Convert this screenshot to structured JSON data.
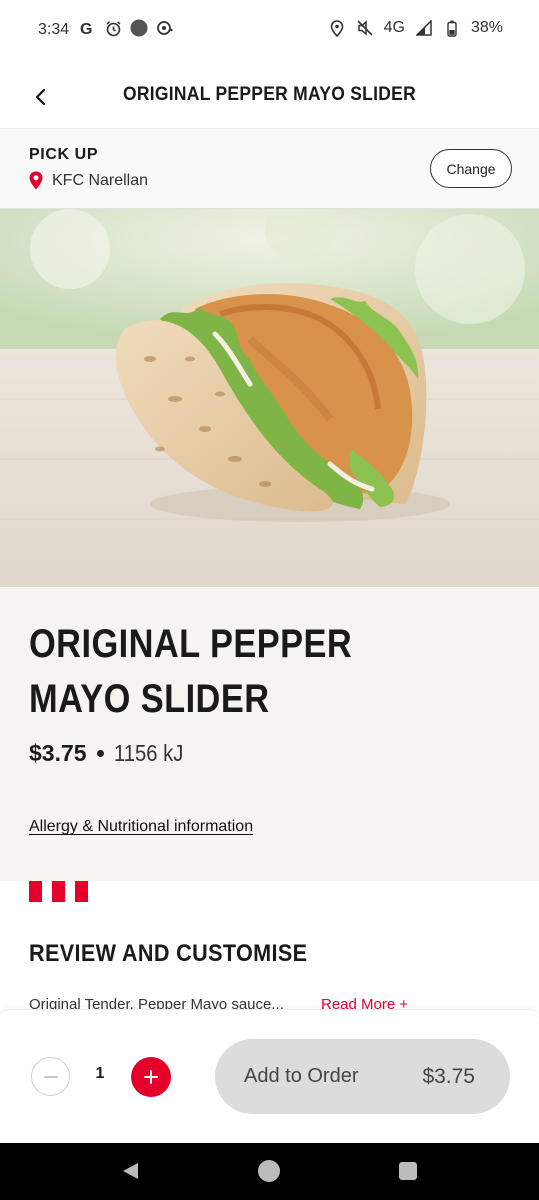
{
  "status_bar": {
    "time": "3:34",
    "network": "4G",
    "battery": "38%",
    "icons": [
      "google-icon",
      "alarm-icon",
      "circle-icon",
      "cast-icon",
      "location-icon",
      "mute-icon",
      "signal-icon",
      "battery-icon"
    ]
  },
  "header": {
    "title": "ORIGINAL PEPPER MAYO SLIDER",
    "back_icon": "chevron-left-icon"
  },
  "pickup": {
    "label": "PICK UP",
    "store": "KFC Narellan",
    "change_label": "Change",
    "pin_color": "#e4002b"
  },
  "product": {
    "name": "ORIGINAL PEPPER MAYO SLIDER",
    "price": "$3.75",
    "energy": "1156 kJ",
    "allergy_link": "Allergy & Nutritional information"
  },
  "review": {
    "title": "REVIEW AND CUSTOMISE",
    "description": "Original Tender, Pepper Mayo sauce...",
    "read_more": "Read More +"
  },
  "order": {
    "quantity": "1",
    "add_label": "Add to Order",
    "add_price": "$3.75"
  },
  "colors": {
    "brand_red": "#e4002b",
    "button_grey": "#dcdcdc",
    "info_background": "#f6f4f1"
  }
}
